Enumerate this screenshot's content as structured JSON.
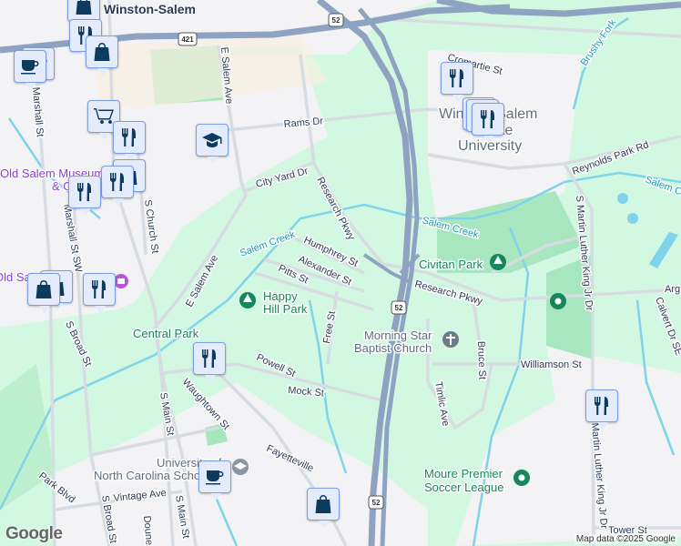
{
  "map": {
    "labels": {
      "top_city": "Winston-Salem",
      "e_salem_ave_n": "E Salem Ave",
      "e_salem_ave_s": "E Salem Ave",
      "rams_dr": "Rams Dr",
      "city_yard_dr": "City Yard Dr",
      "research_pkwy_n": "Research Pkwy",
      "research_pkwy_e": "Research Pkwy",
      "humphrey_st": "Humphrey St",
      "alexander_st": "Alexander St",
      "pitts_st": "Pitts St",
      "free_st": "Free St",
      "powell_st": "Powell St",
      "mock_st": "Mock St",
      "waughtown_st": "Waughtown St",
      "fayetteville": "Fayetteville",
      "s_main_st_1": "S Main St",
      "s_main_st_2": "S Main St",
      "s_broad_st_1": "S Broad St",
      "s_broad_st_2": "S Broad St",
      "marshall_st": "Marshall St",
      "marshall_st_sw": "Marshall St SW",
      "s_church_st": "S Church St",
      "park_blvd": "Park Blvd",
      "vintage_ave": "Vintage Ave",
      "doune": "Doune",
      "cromartie_st": "Cromartie St",
      "reynolds_park_rd": "Reynolds Park Rd",
      "s_mlk_jr_dr": "S Martin Luther King Jr Dr",
      "mlk_jr_dr": "Martin Luther King Jr Dr",
      "williamson_st": "Williamson St",
      "bruce_st": "Bruce St",
      "timlic_ave": "Timlic Ave",
      "calvert_dr": "Calvert Dr SE",
      "tower_st": "Tower St",
      "arg": "Arg",
      "salem_creek_1": "Salem Creek",
      "salem_creek_2": "Salem Creek",
      "salem_creek_3": "Salem Cr",
      "brushy_fork": "Brushy Fork",
      "wssu_1": "Winston-Salem",
      "wssu_2": "State",
      "wssu_3": "University",
      "civitan_park": "Civitan Park",
      "happy_hill_park_1": "Happy",
      "happy_hill_park_2": "Hill Park",
      "central_park": "Central Park",
      "morning_star_1": "Morning Star",
      "morning_star_2": "Baptist Church",
      "moure_1": "Moure Premier",
      "moure_2": "Soccer League",
      "uncsa_1": "University of",
      "uncsa_2": "North Carolina School",
      "old_salem_1": "Old Salem Museums",
      "old_salem_2": "& Gardens",
      "old_salem_3": "Old Salem",
      "us421": "421",
      "us52_top": "52",
      "us52_mid": "52",
      "us52_bot": "52"
    },
    "attribution": "Map data ©2025 Google",
    "logo": "Google",
    "colors": {
      "land": "#f3f2f4",
      "green": "#d3f8e2",
      "park": "#a8e6c0",
      "highway": "#8ea3c1",
      "road": "#d7dce3",
      "water": "#7fd3ea",
      "marker_fill": "#e4ecfb",
      "marker_icon": "#0d3b5e"
    }
  }
}
